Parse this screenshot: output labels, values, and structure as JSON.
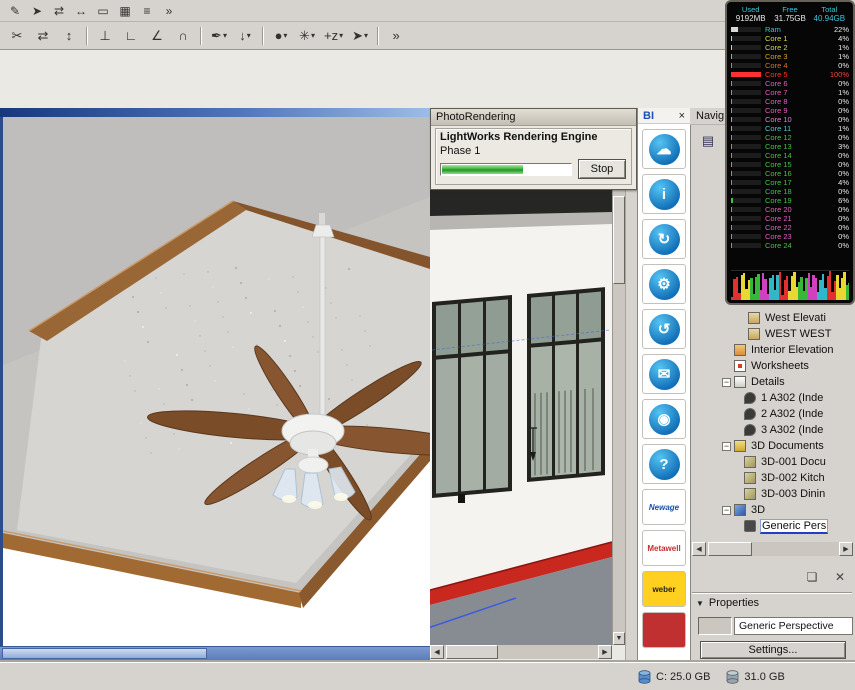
{
  "glyphs": {
    "close": "×",
    "caret": "▾",
    "minus": "−",
    "left": "◀",
    "right": "▶",
    "down": "▼",
    "properties_arrow": "▼",
    "panel": "▤",
    "copy": "❏",
    "x": "✕"
  },
  "toolbar_row1": {
    "items": [
      {
        "name": "pencil",
        "glyph": "✎"
      },
      {
        "name": "select",
        "glyph": "➤"
      },
      {
        "name": "swap",
        "glyph": "⇄"
      },
      {
        "name": "stretch",
        "glyph": "↔"
      },
      {
        "name": "box",
        "glyph": "▭"
      },
      {
        "name": "hatch",
        "glyph": "▦"
      },
      {
        "name": "layers",
        "glyph": "≡"
      },
      {
        "name": "more",
        "glyph": "»"
      }
    ]
  },
  "toolbar_row2": {
    "items": [
      {
        "name": "knife",
        "glyph": "✂"
      },
      {
        "name": "trim",
        "glyph": "⇄"
      },
      {
        "name": "split",
        "glyph": "↕"
      },
      {
        "sep": true
      },
      {
        "name": "adjust",
        "glyph": "⊥"
      },
      {
        "name": "corner",
        "glyph": "∟"
      },
      {
        "name": "angle",
        "glyph": "∠"
      },
      {
        "name": "fillet",
        "glyph": "∩"
      },
      {
        "sep": true
      },
      {
        "name": "pickup-params",
        "glyph": "✒",
        "dropdown": true
      },
      {
        "name": "inject-params",
        "glyph": "↓",
        "dropdown": true
      },
      {
        "sep": true
      },
      {
        "name": "hotspot",
        "glyph": "●",
        "dropdown": true
      },
      {
        "name": "magic",
        "glyph": "✳",
        "dropdown": true
      },
      {
        "name": "elevation-z",
        "glyph": "+z",
        "dropdown": true
      },
      {
        "name": "arrow-tool",
        "glyph": "➤",
        "dropdown": true
      },
      {
        "sep": true
      },
      {
        "name": "more-tools",
        "glyph": "»"
      }
    ]
  },
  "rendering_dialog": {
    "title": "PhotoRendering",
    "engine_line": "LightWorks Rendering Engine",
    "phase_line": "Phase 1",
    "progress_percent": 63,
    "stop_label": "Stop"
  },
  "bi_panel": {
    "title": "BI",
    "buttons": [
      {
        "name": "cloud",
        "glyph": "☁"
      },
      {
        "name": "info",
        "glyph": "i"
      },
      {
        "name": "sync",
        "glyph": "↻"
      },
      {
        "name": "settings-gear",
        "glyph": "⚙"
      },
      {
        "name": "refresh",
        "glyph": "↺"
      },
      {
        "name": "mail",
        "glyph": "✉"
      },
      {
        "name": "camera",
        "glyph": "◉"
      },
      {
        "name": "help",
        "glyph": "?"
      }
    ],
    "logos": [
      {
        "name": "newage",
        "text": "Newage",
        "fg": "#1a50a8",
        "bg": "#ffffff",
        "italic": true
      },
      {
        "name": "metawell",
        "text": "Metawell",
        "fg": "#c03030",
        "bg": "#ffffff",
        "italic": false
      },
      {
        "name": "weber",
        "text": "weber",
        "fg": "#222222",
        "bg": "#ffd020",
        "italic": false
      },
      {
        "name": "red-logo",
        "text": "",
        "fg": "#ffffff",
        "bg": "#c03030",
        "italic": false
      }
    ]
  },
  "navigator": {
    "title": "Navig",
    "tree": [
      {
        "label": "West Elevati",
        "icon": "elev",
        "indent": 56
      },
      {
        "label": "WEST WEST",
        "icon": "elev",
        "indent": 56
      },
      {
        "label": "Interior Elevation",
        "icon": "intelev",
        "indent": 42
      },
      {
        "label": "Worksheets",
        "icon": "sheet",
        "indent": 42
      },
      {
        "label": "Details",
        "icon": "folder",
        "indent": 30,
        "expander": true
      },
      {
        "label": "1 A302 (Inde",
        "icon": "detail",
        "indent": 52
      },
      {
        "label": "2 A302 (Inde",
        "icon": "detail",
        "indent": 52
      },
      {
        "label": "3 A302 (Inde",
        "icon": "detail",
        "indent": 52
      },
      {
        "label": "3D Documents",
        "icon": "doc3d",
        "indent": 30,
        "expander": true
      },
      {
        "label": "3D-001 Docu",
        "icon": "cube",
        "indent": 52
      },
      {
        "label": "3D-002 Kitch",
        "icon": "cube",
        "indent": 52
      },
      {
        "label": "3D-003 Dinin",
        "icon": "cube",
        "indent": 52
      },
      {
        "label": "3D",
        "icon": "cube3d",
        "indent": 30,
        "expander": true
      },
      {
        "label": "Generic Pers",
        "icon": "camera",
        "indent": 52,
        "selected": true
      }
    ],
    "properties_label": "Properties",
    "perspective_value": "Generic Perspective",
    "settings_label": "Settings..."
  },
  "system_monitor": {
    "headers": {
      "used": "Used",
      "free": "Free",
      "total": "Total"
    },
    "values": {
      "used": "9192MB",
      "free": "31.75GB",
      "total": "40.94GB"
    },
    "ram": {
      "label": "Ram",
      "value": "22%",
      "percent": 22
    },
    "cores": [
      {
        "label": "Core 1",
        "value": "4%",
        "percent": 4,
        "color": "#d8d848"
      },
      {
        "label": "Core 2",
        "value": "1%",
        "percent": 1,
        "color": "#d8d848"
      },
      {
        "label": "Core 3",
        "value": "1%",
        "percent": 1,
        "color": "#d8a028"
      },
      {
        "label": "Core 4",
        "value": "0%",
        "percent": 0,
        "color": "#d87828"
      },
      {
        "label": "Core 5",
        "value": "100%",
        "percent": 100,
        "color": "#ff3030"
      },
      {
        "label": "Core 6",
        "value": "0%",
        "percent": 0,
        "color": "#e060c0"
      },
      {
        "label": "Core 7",
        "value": "1%",
        "percent": 1,
        "color": "#e060c0"
      },
      {
        "label": "Core 8",
        "value": "0%",
        "percent": 0,
        "color": "#e060c0"
      },
      {
        "label": "Core 9",
        "value": "0%",
        "percent": 0,
        "color": "#e060c0"
      },
      {
        "label": "Core 10",
        "value": "0%",
        "percent": 0,
        "color": "#e080d0"
      },
      {
        "label": "Core 11",
        "value": "1%",
        "percent": 1,
        "color": "#50c8d8"
      },
      {
        "label": "Core 12",
        "value": "0%",
        "percent": 0,
        "color": "#48c048"
      },
      {
        "label": "Core 13",
        "value": "3%",
        "percent": 3,
        "color": "#48c048"
      },
      {
        "label": "Core 14",
        "value": "0%",
        "percent": 0,
        "color": "#48c048"
      },
      {
        "label": "Core 15",
        "value": "0%",
        "percent": 0,
        "color": "#48c048"
      },
      {
        "label": "Core 16",
        "value": "0%",
        "percent": 0,
        "color": "#48c048"
      },
      {
        "label": "Core 17",
        "value": "4%",
        "percent": 4,
        "color": "#48c048"
      },
      {
        "label": "Core 18",
        "value": "0%",
        "percent": 0,
        "color": "#48c048"
      },
      {
        "label": "Core 19",
        "value": "6%",
        "percent": 6,
        "color": "#48c048"
      },
      {
        "label": "Core 20",
        "value": "0%",
        "percent": 0,
        "color": "#e060c0"
      },
      {
        "label": "Core 21",
        "value": "0%",
        "percent": 0,
        "color": "#e060c0"
      },
      {
        "label": "Core 22",
        "value": "0%",
        "percent": 0,
        "color": "#e060c0"
      },
      {
        "label": "Core 23",
        "value": "0%",
        "percent": 0,
        "color": "#e060c0"
      },
      {
        "label": "Core 24",
        "value": "0%",
        "percent": 0,
        "color": "#48c048"
      }
    ]
  },
  "statusbar": {
    "disk_c": "C: 25.0 GB",
    "disk_d": "31.0 GB"
  }
}
